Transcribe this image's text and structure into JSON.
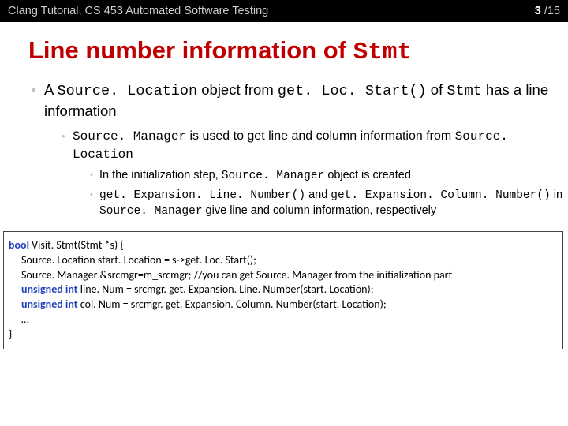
{
  "header": {
    "left": "Clang Tutorial, CS 453 Automated Software Testing",
    "page_current": "3",
    "page_sep": " /",
    "page_total": "15"
  },
  "title_pre": "Line number information of ",
  "title_mono": "Stmt",
  "b1_a": "A ",
  "b1_mono1": "Source. Location",
  "b1_b": " object from ",
  "b1_mono2": "get. Loc. Start()",
  "b1_c": " of ",
  "b1_mono3": "Stmt",
  "b1_d": " has a line information",
  "b2_mono1": "Source. Manager",
  "b2_a": " is used to get line and column information from ",
  "b2_mono2": "Source. Location",
  "b3_a": "In the initialization step, ",
  "b3_mono1": "Source. Manager",
  "b3_b": " object is created",
  "b4_mono1": "get. Expansion. Line. Number()",
  "b4_a": " and ",
  "b4_mono2": "get. Expansion. Column. Number()",
  "b4_b": " in ",
  "b4_mono3": "Source. Manager",
  "b4_c": " give line and column information, respectively",
  "code": {
    "l1_kw": "bool",
    "l1_rest": " Visit. Stmt(Stmt *s) {",
    "l2": "Source. Location start. Location = s->get. Loc. Start();",
    "l3": "Source. Manager &srcmgr=m_srcmgr; //you can get Source. Manager from the initialization part",
    "l4_kw": "unsigned int",
    "l4_rest": " line. Num = srcmgr. get. Expansion. Line. Number(start. Location);",
    "l5_kw": "unsigned int",
    "l5_rest": " col. Num = srcmgr. get. Expansion. Column. Number(start. Location);",
    "l6": "…",
    "l7": "}"
  }
}
